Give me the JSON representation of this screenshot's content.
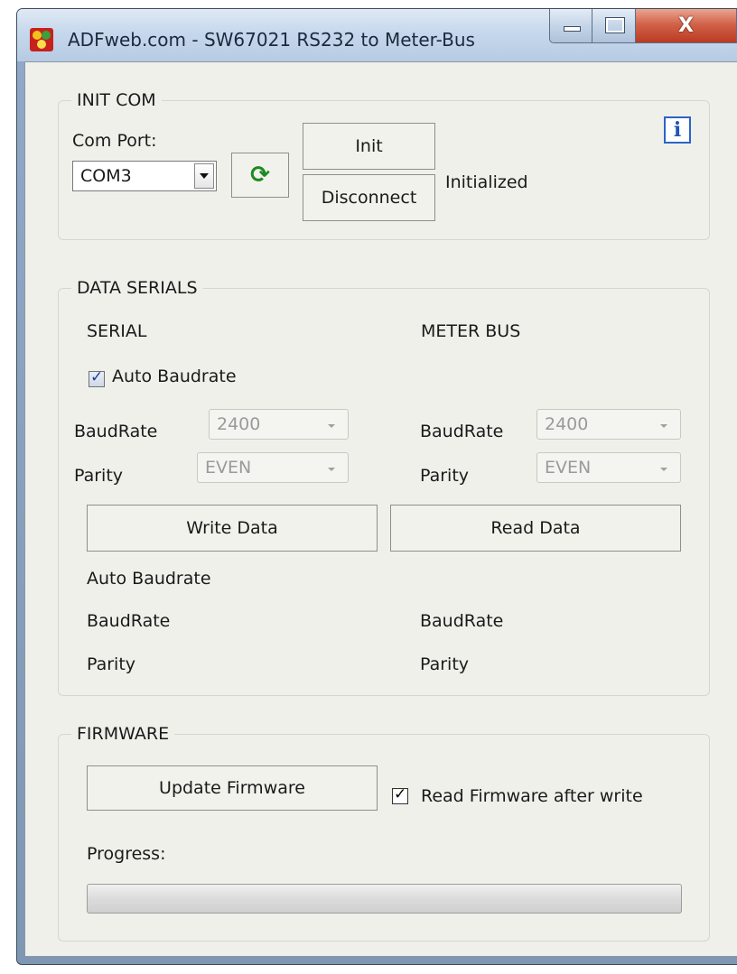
{
  "window": {
    "title": "ADFweb.com - SW67021 RS232 to Meter-Bus",
    "close_glyph": "X"
  },
  "init_com": {
    "group_label": "INIT COM",
    "com_port_label": "Com Port:",
    "com_port_value": "COM3",
    "init_button": "Init",
    "disconnect_button": "Disconnect",
    "status": "Initialized",
    "info_glyph": "i"
  },
  "data_serials": {
    "group_label": "DATA SERIALS",
    "serial_header": "SERIAL",
    "meterbus_header": "METER BUS",
    "auto_baudrate_label": "Auto Baudrate",
    "auto_baudrate_checked": true,
    "serial": {
      "baudrate_label": "BaudRate",
      "baudrate_value": "2400",
      "parity_label": "Parity",
      "parity_value": "EVEN"
    },
    "meterbus": {
      "baudrate_label": "BaudRate",
      "baudrate_value": "2400",
      "parity_label": "Parity",
      "parity_value": "EVEN"
    },
    "write_button": "Write Data",
    "read_button": "Read Data",
    "readback": {
      "auto_baudrate_label": "Auto Baudrate",
      "serial_baudrate_label": "BaudRate",
      "serial_parity_label": "Parity",
      "meterbus_baudrate_label": "BaudRate",
      "meterbus_parity_label": "Parity"
    }
  },
  "firmware": {
    "group_label": "FIRMWARE",
    "update_button": "Update Firmware",
    "read_after_write_label": "Read Firmware after write",
    "read_after_write_checked": true,
    "progress_label": "Progress:",
    "progress_value": 0
  }
}
